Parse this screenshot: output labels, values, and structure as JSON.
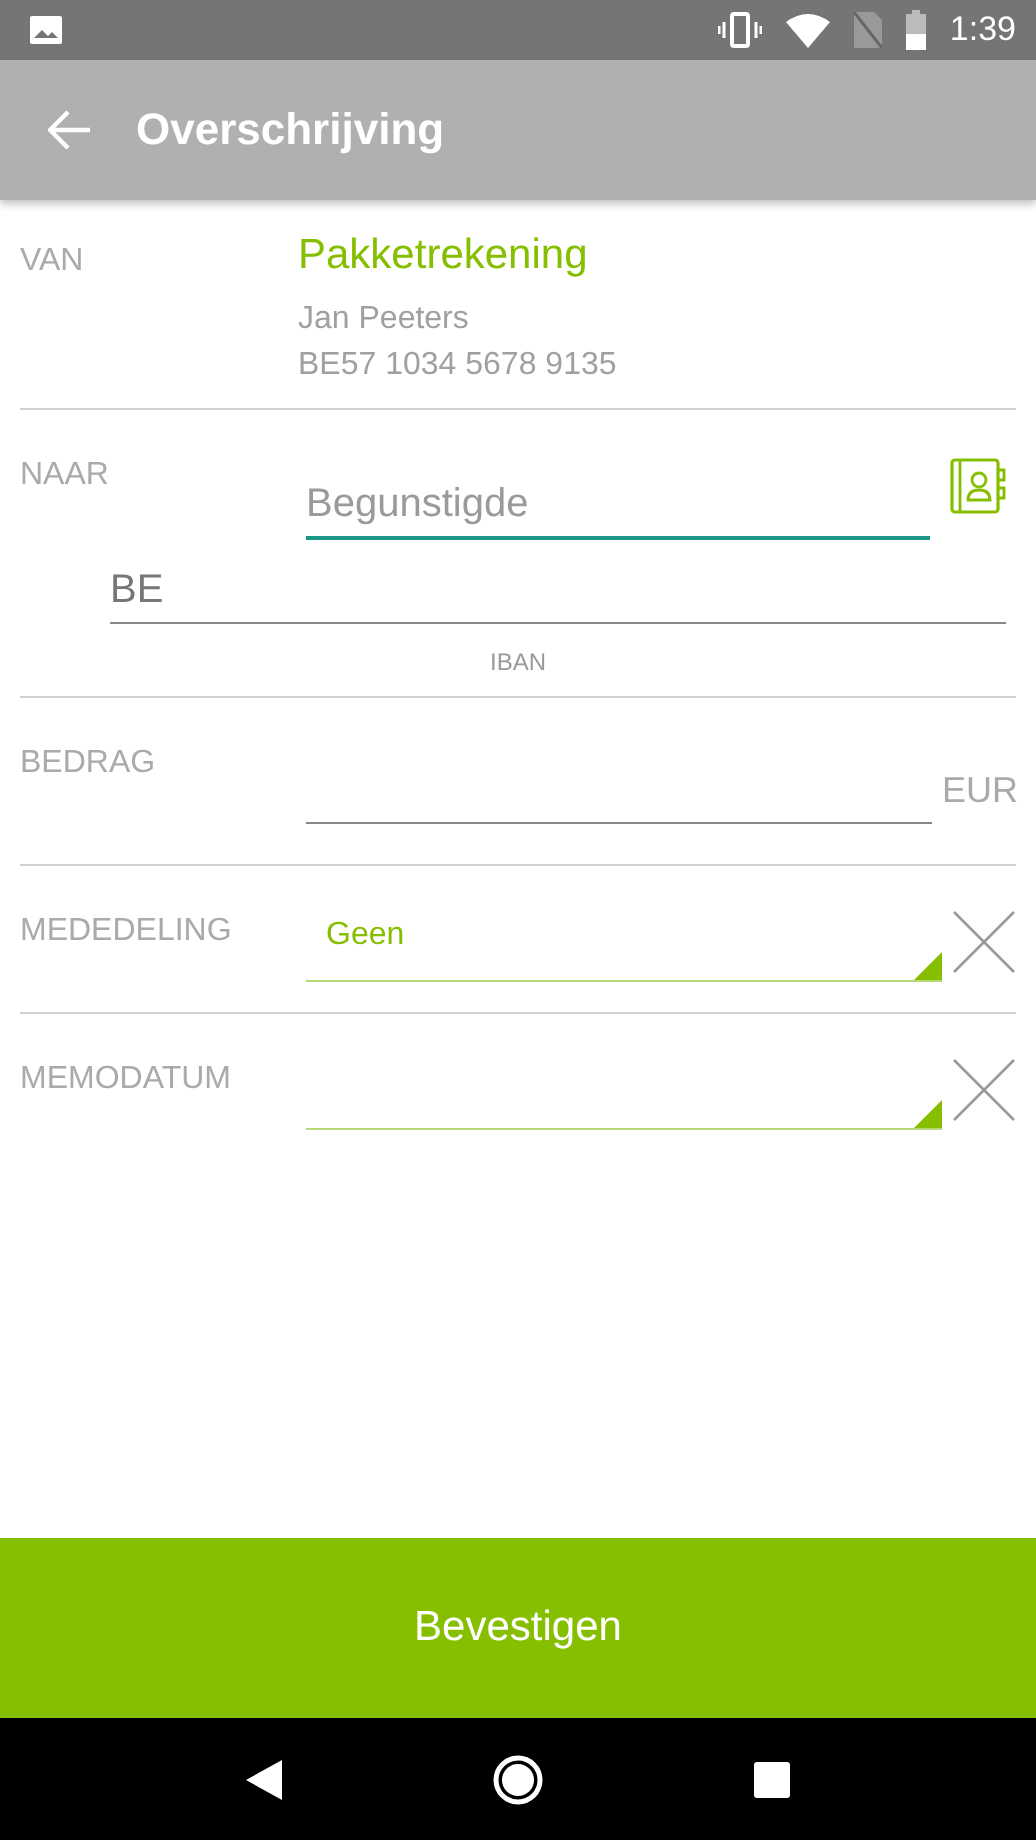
{
  "status_bar": {
    "time": "1:39"
  },
  "app_bar": {
    "title": "Overschrijving"
  },
  "from": {
    "label": "VAN",
    "account": "Pakketrekening",
    "holder": "Jan Peeters",
    "iban": "BE57 1034 5678 9135"
  },
  "to": {
    "label": "NAAR",
    "beneficiary": {
      "placeholder": "Begunstigde",
      "focused": true
    },
    "iban": {
      "value": "BE",
      "caption": "IBAN"
    }
  },
  "amount": {
    "label": "BEDRAG",
    "currency": "EUR"
  },
  "selects": [
    {
      "label": "MEDEDELING",
      "value": "Geen"
    },
    {
      "label": "MEMODATUM"
    }
  ],
  "confirm_button": "Bevestigen"
}
